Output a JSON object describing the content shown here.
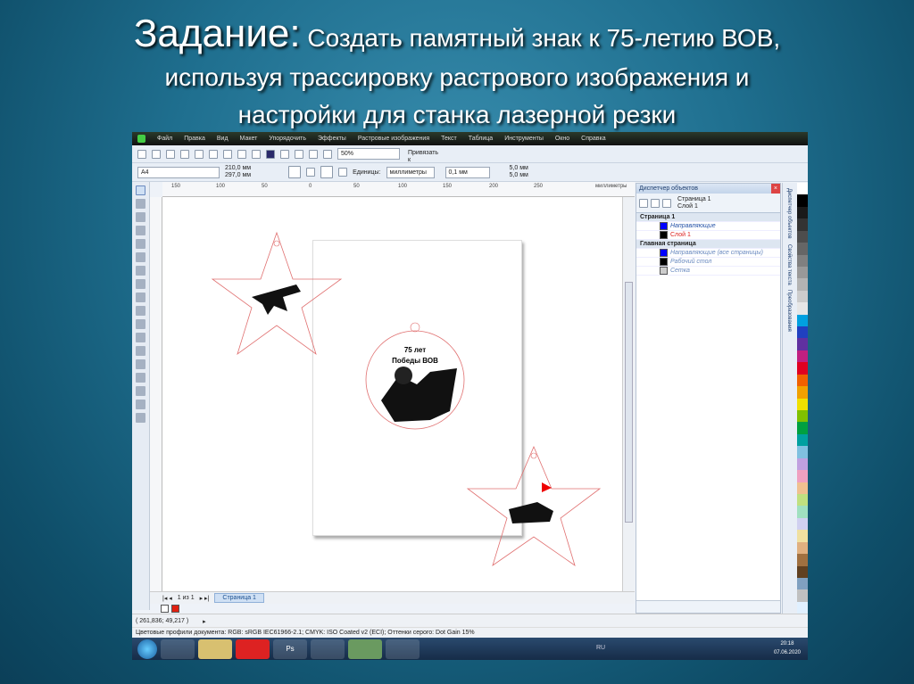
{
  "slide": {
    "title_lead": "Задание:",
    "title_rest": " Создать памятный знак к 75-летию ВОВ,",
    "line2": "используя   трассировку растрового изображения и",
    "line3": "настройки для станка лазерной резки"
  },
  "menu": [
    "Файл",
    "Правка",
    "Вид",
    "Макет",
    "Упорядочить",
    "Эффекты",
    "Растровые изображения",
    "Текст",
    "Таблица",
    "Инструменты",
    "Окно",
    "Справка"
  ],
  "toolbar": {
    "zoom": "50%",
    "snap": "Привязать к"
  },
  "propbar": {
    "page_size": "A4",
    "width": "210,0 мм",
    "height": "297,0 мм",
    "units_label": "Единицы:",
    "units": "миллиметры",
    "nudge": "0,1 мм",
    "dup_x": "5,0 мм",
    "dup_y": "5,0 мм"
  },
  "ruler": {
    "ticks": [
      "150",
      "100",
      "50",
      "0",
      "50",
      "100",
      "150",
      "200",
      "250"
    ],
    "unit": "миллиметры"
  },
  "canvas": {
    "medal_line1": "75 лет",
    "medal_line2": "Победы ВОВ"
  },
  "pagenav": {
    "count": "1 из 1",
    "tab": "Страница 1"
  },
  "docker": {
    "title": "Диспетчер объектов",
    "current_page": "Страница 1",
    "current_layer": "Слой 1",
    "rows": [
      {
        "name": "Страница 1",
        "group": true
      },
      {
        "name": "Направляющие",
        "color": "#0000ff"
      },
      {
        "name": "Слой 1",
        "color": "#000000"
      },
      {
        "name": "Главная страница",
        "group": true
      },
      {
        "name": "Направляющие (все страницы)",
        "color": "#0000ff"
      },
      {
        "name": "Рабочий стол",
        "color": "#000000"
      },
      {
        "name": "Сетка",
        "color": "#cccccc"
      }
    ]
  },
  "sidetabs": [
    "Диспетчер объектов",
    "Свойства текста",
    "Преобразования"
  ],
  "status": {
    "coords": "( 261,836; 49,217 )",
    "profile": "Цветовые профили документа: RGB: sRGB IEC61966-2.1; CMYK: ISO Coated v2 (ECI); Оттенки серого: Dot Gain 15%"
  },
  "taskbar": {
    "lang": "RU",
    "time": "20:18",
    "date": "07.06.2020",
    "apps": [
      "Ps"
    ]
  },
  "palette": [
    "#ffffff",
    "#000000",
    "#1a1a1a",
    "#333",
    "#4d4d4d",
    "#666",
    "#808080",
    "#999",
    "#b3b3b3",
    "#ccc",
    "#e6e6e6",
    "#00a0e0",
    "#2040c0",
    "#6030a0",
    "#c02080",
    "#e00020",
    "#f06000",
    "#f0a000",
    "#f0e000",
    "#80c000",
    "#00a040",
    "#00a0a0",
    "#80c0e0",
    "#c0a0e0",
    "#f0a0c0",
    "#f0c090",
    "#c0e080",
    "#a0e0c0",
    "#d0d0f0",
    "#f0e0a0",
    "#e0b080",
    "#a07040",
    "#604020",
    "#80a0c0",
    "#c0c0c0",
    "#e0f0ff"
  ]
}
